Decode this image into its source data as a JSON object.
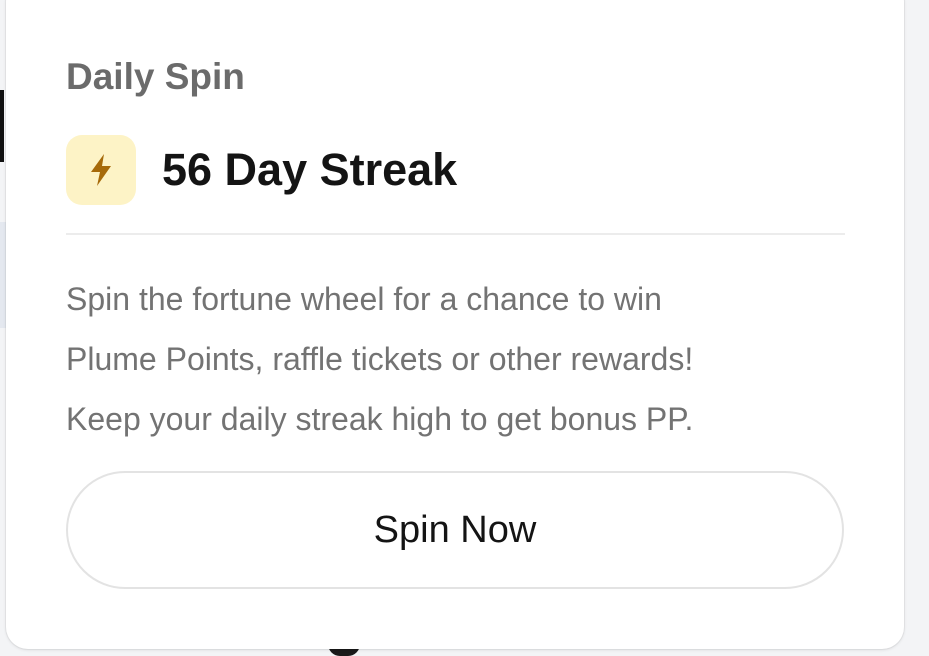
{
  "card": {
    "title": "Daily Spin",
    "streak": {
      "icon": "lightning-bolt-icon",
      "icon_color": "#a66a0a",
      "icon_background": "#fdf3c6",
      "label": "56 Day Streak"
    },
    "description_lines": [
      "Spin the fortune wheel for a chance to win",
      "Plume Points, raffle tickets or other rewards!",
      "Keep your daily streak high to get bonus PP."
    ],
    "button_label": "Spin Now"
  }
}
